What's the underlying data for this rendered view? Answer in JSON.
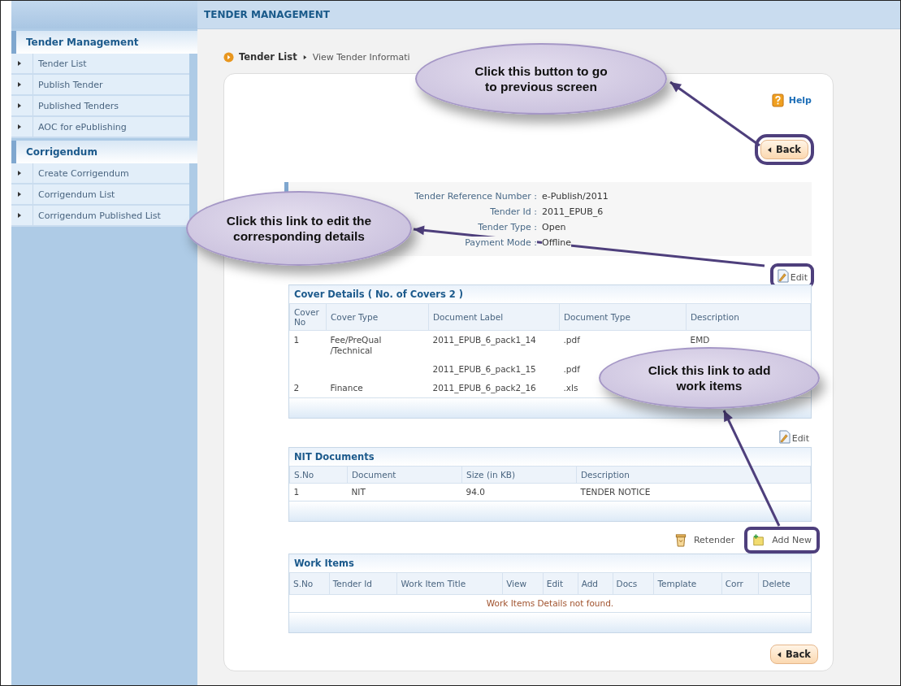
{
  "header": {
    "title": "TENDER MANAGEMENT"
  },
  "sidebar": {
    "sections": [
      {
        "title": "Tender Management",
        "items": [
          "Tender List",
          "Publish Tender",
          "Published Tenders",
          "AOC for ePublishing"
        ]
      },
      {
        "title": "Corrigendum",
        "items": [
          "Create Corrigendum",
          "Corrigendum List",
          "Corrigendum Published List"
        ]
      }
    ]
  },
  "breadcrumb": {
    "parent": "Tender List",
    "current": "View Tender Informati"
  },
  "help_link": "Help",
  "back_top": {
    "label": "Back",
    "highlighted": true
  },
  "tender_info": [
    {
      "label": "Tender Reference Number :",
      "value": "e-Publish/2011"
    },
    {
      "label": "Tender Id :",
      "value": "2011_EPUB_6"
    },
    {
      "label": "Tender Type :",
      "value": "Open"
    },
    {
      "label": "Payment Mode :",
      "value": "Offline"
    }
  ],
  "info_edit": {
    "label": "Edit",
    "highlighted": true
  },
  "cover_details": {
    "title": "Cover Details ( No. of Covers 2 )",
    "columns": [
      "Cover No",
      "Cover Type",
      "Document Label",
      "Document Type",
      "Description"
    ],
    "rows": [
      {
        "cells": [
          "1",
          "Fee/PreQual /Technical",
          "2011_EPUB_6_pack1_14",
          ".pdf",
          "EMD"
        ]
      },
      {
        "cells": [
          "",
          "",
          "2011_EPUB_6_pack1_15",
          ".pdf"
        ]
      },
      {
        "cells": [
          "2",
          "Finance",
          "2011_EPUB_6_pack2_16",
          ".xls"
        ]
      }
    ]
  },
  "cover_edit": {
    "label": "Edit",
    "highlighted": false
  },
  "nit_documents": {
    "title": "NIT Documents",
    "columns": [
      "S.No",
      "Document",
      "Size (in KB)",
      "Description"
    ],
    "rows": [
      [
        "1",
        "NIT",
        "94.0",
        "TENDER NOTICE"
      ]
    ]
  },
  "actions": [
    {
      "kind": "retender",
      "label": "Retender",
      "highlighted": false
    },
    {
      "kind": "add",
      "label": "Add New",
      "highlighted": true
    }
  ],
  "work_items": {
    "title": "Work Items",
    "columns": [
      "S.No",
      "Tender Id",
      "Work Item Title",
      "View",
      "Edit",
      "Add",
      "Docs",
      "Template",
      "Corr",
      "Delete"
    ],
    "empty_message": "Work Items Details not found."
  },
  "back_bottom": {
    "label": "Back",
    "highlighted": false
  },
  "callouts": [
    {
      "text": "Click this button to go to previous screen"
    },
    {
      "text": "Click this link to edit the corresponding details"
    },
    {
      "text": "Click this link to add work items"
    }
  ]
}
